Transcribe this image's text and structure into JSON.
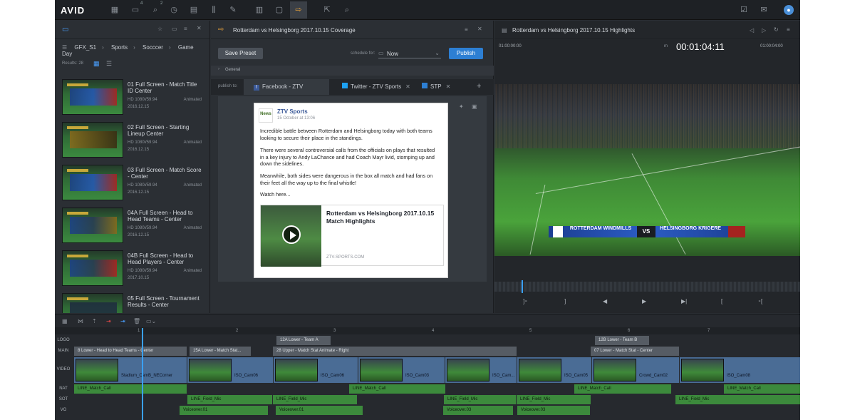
{
  "app": {
    "logo": "AVID"
  },
  "toolbar": {
    "badge1": "4",
    "badge2": "2"
  },
  "browser": {
    "breadcrumbs": [
      "GFX_S1",
      "Sports",
      "Socccer",
      "Game Day"
    ],
    "results": "Results: 28",
    "items": [
      {
        "title": "01 Full Screen - Match Title ID Center",
        "format": "HD 1080i/59.94",
        "kind": "Animated",
        "date": "2016.12.15"
      },
      {
        "title": "02 Full Screen - Starting Lineup Center",
        "format": "HD 1080i/59.94",
        "kind": "Animated",
        "date": "2016.12.15"
      },
      {
        "title": "03 Full Screen - Match Score - Center",
        "format": "HD 1080i/59.94",
        "kind": "Animated",
        "date": "2016.12.15"
      },
      {
        "title": "04A Full Screen - Head to Head Teams - Center",
        "format": "HD 1080i/59.94",
        "kind": "Animated",
        "date": "2016.12.15"
      },
      {
        "title": "04B Full Screen - Head to Head Players - Center",
        "format": "HD 1080i/59.94",
        "kind": "Animated",
        "date": "2017.10.15"
      },
      {
        "title": "05 Full Screen - Tournament Results - Center",
        "format": "",
        "kind": "",
        "date": ""
      }
    ]
  },
  "publish": {
    "title": "Rotterdam vs Helsingborg 2017.10.15 Coverage",
    "save_preset": "Save Preset",
    "schedule_label": "schedule for:",
    "schedule_value": "Now",
    "publish_button": "Publish",
    "section": "General",
    "publish_to": "publish to:",
    "tabs": [
      "Facebook - ZTV Sports",
      "Twitter - ZTV Sports",
      "STP"
    ],
    "post": {
      "author": "ZTV Sports",
      "date": "15 October at 13:06",
      "logo_text": "News",
      "p1": "Incredible battle between Rotterdam and Helsingborg today with both teams looking to secure their place in the standings.",
      "p2": "There were several controversial calls from the officials on plays that resulted in a key injury to Andy LaChance and had Coach Mayr livid, stomping up and down the sidelines.",
      "p3": "Meanwhile, both sides were dangerous in the box all match and had fans on their feet all the way up to the final whistle!",
      "p4": "Watch here...",
      "card_title": "Rotterdam vs Helsingborg 2017.10.15 Match Highlights",
      "card_domain": "ZTV-SPORTS.COM"
    }
  },
  "player": {
    "title": "Rotterdam vs Helsingborg 2017.10.15 Highlights",
    "tc_in": "01:00:00:00",
    "tc_main": "00:01:04:11",
    "tc_out": "01:00:04:00",
    "tc_mode": "m",
    "home": "ROTTERDAM WINDMILLS",
    "vs": "VS",
    "away": "HELSINGBORG KRIGERE"
  },
  "timeline": {
    "tracks": [
      "LOGO",
      "MAIN",
      "VIDEO",
      "NAT",
      "SOT",
      "VO"
    ],
    "ruler": [
      "1",
      "2",
      "3",
      "4",
      "5",
      "6",
      "7"
    ],
    "logo_clips": [
      "12A Lower - Team A",
      "12B Lower - Team B"
    ],
    "main_clips": [
      "8 Lower - Head to Head Teams - Center",
      "15A Lower - Match Stat...",
      "28 Upper - Match Stat Animate - Right",
      "07 Lower - Match Stat - Center"
    ],
    "video_clips": [
      "Stadium_CamB_NECorner",
      "ISO_Cam06",
      "ISO_Cam06",
      "ISO_Cam03",
      "ISO_Cam...",
      "ISO_Cam05",
      "Crowd_Cam02",
      "ISO_Cam08"
    ],
    "nat_clips": [
      "LINE_Match_Call",
      "LINE_Match_Call",
      "LINE_Match_Call",
      "LINE_Match_Call"
    ],
    "sot_clips": [
      "LINE_Field_Mic",
      "LINE_Field_Mic",
      "LINE_Field_Mic",
      "LINE_Field_Mic",
      "LINE_Field_Mic"
    ],
    "vo_clips": [
      "Voiceover.01",
      "Voiceover.01",
      "Voiceover.03",
      "Voiceover.03"
    ]
  }
}
